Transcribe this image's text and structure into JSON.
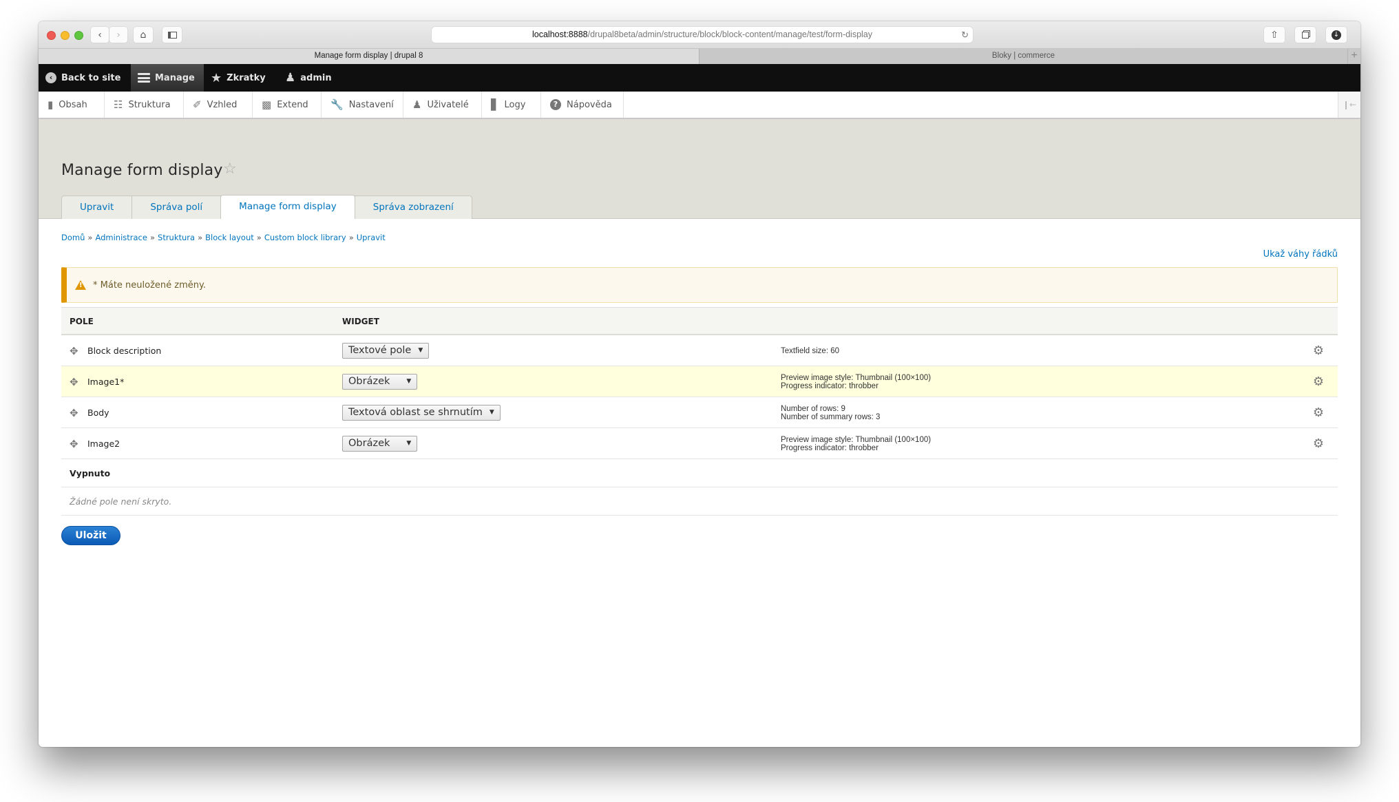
{
  "browser": {
    "url_host": "localhost:8888",
    "url_path": "/drupal8beta/admin/structure/block/block-content/manage/test/form-display",
    "tabs": [
      {
        "title": "Manage form display | drupal 8",
        "active": true
      },
      {
        "title": "Bloky | commerce",
        "active": false
      }
    ],
    "new_tab_label": "+"
  },
  "adminbar": {
    "items": [
      {
        "label": "Back to site",
        "icon": "back-arrow-icon"
      },
      {
        "label": "Manage",
        "icon": "menu-icon",
        "active": true
      },
      {
        "label": "Zkratky",
        "icon": "star-icon"
      },
      {
        "label": "admin",
        "icon": "user-icon"
      }
    ]
  },
  "tray": {
    "items": [
      {
        "label": "Obsah",
        "icon": "file-icon"
      },
      {
        "label": "Struktura",
        "icon": "sitemap-icon"
      },
      {
        "label": "Vzhled",
        "icon": "paint-brush-icon"
      },
      {
        "label": "Extend",
        "icon": "puzzle-icon"
      },
      {
        "label": "Nastavení",
        "icon": "wrench-icon"
      },
      {
        "label": "Uživatelé",
        "icon": "users-icon"
      },
      {
        "label": "Logy",
        "icon": "bar-chart-icon"
      },
      {
        "label": "Nápověda",
        "icon": "help-icon"
      }
    ]
  },
  "page": {
    "title": "Manage form display",
    "tabs": [
      {
        "label": "Upravit",
        "active": false
      },
      {
        "label": "Správa polí",
        "active": false
      },
      {
        "label": "Manage form display",
        "active": true
      },
      {
        "label": "Správa zobrazení",
        "active": false
      }
    ],
    "breadcrumb": [
      "Domů",
      "Administrace",
      "Struktura",
      "Block layout",
      "Custom block library",
      "Upravit"
    ],
    "breadcrumb_sep": "»",
    "show_weights_link": "Ukaž váhy řádků",
    "warning": "* Máte neuložené změny.",
    "table": {
      "headers": {
        "field": "POLE",
        "widget": "WIDGET"
      },
      "rows": [
        {
          "name": "Block description",
          "widget": "Textové pole",
          "summary": [
            "Textfield size: 60"
          ],
          "changed": false
        },
        {
          "name": "Image1*",
          "widget": "Obrázek",
          "summary": [
            "Preview image style: Thumbnail (100×100)",
            "Progress indicator: throbber"
          ],
          "changed": true
        },
        {
          "name": "Body",
          "widget": "Textová oblast se shrnutím",
          "summary": [
            "Number of rows: 9",
            "Number of summary rows: 3"
          ],
          "changed": false
        },
        {
          "name": "Image2",
          "widget": "Obrázek",
          "summary": [
            "Preview image style: Thumbnail (100×100)",
            "Progress indicator: throbber"
          ],
          "changed": false
        }
      ],
      "disabled_region": "Vypnuto",
      "disabled_empty": "Žádné pole není skryto."
    },
    "save_label": "Uložit"
  },
  "colors": {
    "link": "#0074bd",
    "warning_accent": "#e09600",
    "changed_row": "#ffffdd",
    "primary_button": "#1b6fc8"
  }
}
